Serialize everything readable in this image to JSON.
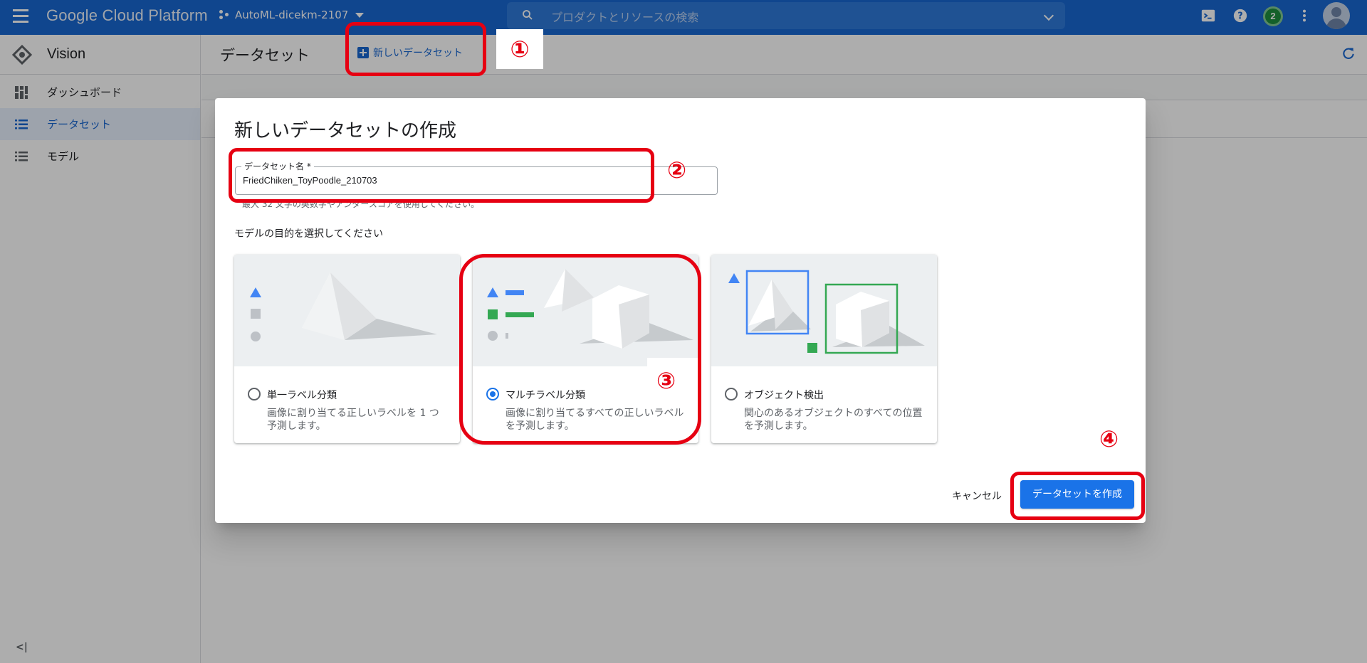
{
  "topbar": {
    "app_name": "Google Cloud Platform",
    "project": "AutoML-dicekm-2107",
    "search_placeholder": "プロダクトとリソースの検索",
    "notification_count": "2"
  },
  "sidebar": {
    "product": "Vision",
    "items": [
      {
        "label": "ダッシュボード",
        "icon": "dashboard-icon",
        "active": false
      },
      {
        "label": "データセット",
        "icon": "list-icon",
        "active": true
      },
      {
        "label": "モデル",
        "icon": "list-icon",
        "active": false
      }
    ],
    "collapse_label": "<|"
  },
  "main": {
    "title": "データセット",
    "new_dataset_label": "新しいデータセット"
  },
  "dialog": {
    "title": "新しいデータセットの作成",
    "field_label": "データセット名 *",
    "field_value": "FriedChiken_ToyPoodle_210703",
    "hint": "最大 32 文字の英数字やアンダースコアを使用してください。",
    "purpose_label": "モデルの目的を選択してください",
    "options": [
      {
        "title": "単一ラベル分類",
        "desc": "画像に割り当てる正しいラベルを 1 つ予測します。",
        "selected": false
      },
      {
        "title": "マルチラベル分類",
        "desc": "画像に割り当てるすべての正しいラベルを予測します。",
        "selected": true
      },
      {
        "title": "オブジェクト検出",
        "desc": "関心のあるオブジェクトのすべての位置を予測します。",
        "selected": false
      }
    ],
    "cancel_label": "キャンセル",
    "create_label": "データセットを作成"
  },
  "annotations": {
    "step1": "①",
    "step2": "②",
    "step3": "③",
    "step4": "④",
    "color": "#e60012"
  },
  "colors": {
    "topbar": "#1967d2",
    "accent": "#1a73e8",
    "active_nav_bg": "#e8f0fe"
  }
}
